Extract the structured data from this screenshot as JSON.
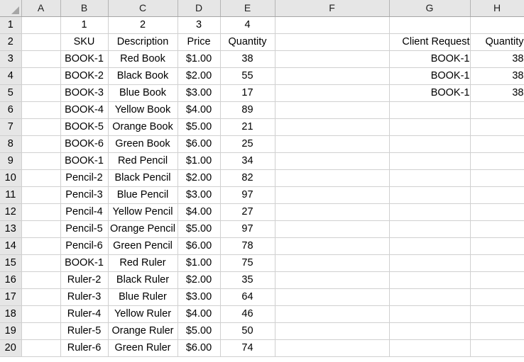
{
  "app": {
    "type": "spreadsheet",
    "select_all_icon": "select-all-triangle-icon"
  },
  "columns": {
    "headers": [
      "A",
      "B",
      "C",
      "D",
      "E",
      "F",
      "G",
      "H"
    ],
    "widths": [
      55,
      67,
      98,
      60,
      77,
      161,
      114,
      76
    ]
  },
  "rows": {
    "numbers": [
      "1",
      "2",
      "3",
      "4",
      "5",
      "6",
      "7",
      "8",
      "9",
      "10",
      "11",
      "12",
      "13",
      "14",
      "15",
      "16",
      "17",
      "18",
      "19",
      "20"
    ]
  },
  "annotations": {
    "row": "1",
    "color": "#ff0000",
    "values": [
      "1",
      "2",
      "3",
      "4"
    ]
  },
  "inventory_table": {
    "header_row": "2",
    "headers": [
      "SKU",
      "Description",
      "Price",
      "Quantity"
    ],
    "rows": [
      {
        "row": "3",
        "sku": "BOOK-1",
        "description": "Red Book",
        "price": "$1.00",
        "quantity": "38",
        "sku_highlight": "pink",
        "row_highlight": "green"
      },
      {
        "row": "4",
        "sku": "BOOK-2",
        "description": "Black Book",
        "price": "$2.00",
        "quantity": "55",
        "sku_highlight": "none",
        "row_highlight": "none"
      },
      {
        "row": "5",
        "sku": "BOOK-3",
        "description": "Blue Book",
        "price": "$3.00",
        "quantity": "17",
        "sku_highlight": "none",
        "row_highlight": "none"
      },
      {
        "row": "6",
        "sku": "BOOK-4",
        "description": "Yellow Book",
        "price": "$4.00",
        "quantity": "89",
        "sku_highlight": "none",
        "row_highlight": "none"
      },
      {
        "row": "7",
        "sku": "BOOK-5",
        "description": "Orange Book",
        "price": "$5.00",
        "quantity": "21",
        "sku_highlight": "none",
        "row_highlight": "none"
      },
      {
        "row": "8",
        "sku": "BOOK-6",
        "description": "Green Book",
        "price": "$6.00",
        "quantity": "25",
        "sku_highlight": "none",
        "row_highlight": "none"
      },
      {
        "row": "9",
        "sku": "BOOK-1",
        "description": "Red Pencil",
        "price": "$1.00",
        "quantity": "34",
        "sku_highlight": "pink",
        "row_highlight": "yellow"
      },
      {
        "row": "10",
        "sku": "Pencil-2",
        "description": "Black Pencil",
        "price": "$2.00",
        "quantity": "82",
        "sku_highlight": "none",
        "row_highlight": "none"
      },
      {
        "row": "11",
        "sku": "Pencil-3",
        "description": "Blue Pencil",
        "price": "$3.00",
        "quantity": "97",
        "sku_highlight": "none",
        "row_highlight": "none"
      },
      {
        "row": "12",
        "sku": "Pencil-4",
        "description": "Yellow Pencil",
        "price": "$4.00",
        "quantity": "27",
        "sku_highlight": "none",
        "row_highlight": "none"
      },
      {
        "row": "13",
        "sku": "Pencil-5",
        "description": "Orange Pencil",
        "price": "$5.00",
        "quantity": "97",
        "sku_highlight": "none",
        "row_highlight": "none"
      },
      {
        "row": "14",
        "sku": "Pencil-6",
        "description": "Green Pencil",
        "price": "$6.00",
        "quantity": "78",
        "sku_highlight": "none",
        "row_highlight": "none"
      },
      {
        "row": "15",
        "sku": "BOOK-1",
        "description": "Red Ruler",
        "price": "$1.00",
        "quantity": "75",
        "sku_highlight": "pink",
        "row_highlight": "yellow"
      },
      {
        "row": "16",
        "sku": "Ruler-2",
        "description": "Black Ruler",
        "price": "$2.00",
        "quantity": "35",
        "sku_highlight": "none",
        "row_highlight": "none"
      },
      {
        "row": "17",
        "sku": "Ruler-3",
        "description": "Blue Ruler",
        "price": "$3.00",
        "quantity": "64",
        "sku_highlight": "none",
        "row_highlight": "none"
      },
      {
        "row": "18",
        "sku": "Ruler-4",
        "description": "Yellow Ruler",
        "price": "$4.00",
        "quantity": "46",
        "sku_highlight": "none",
        "row_highlight": "none"
      },
      {
        "row": "19",
        "sku": "Ruler-5",
        "description": "Orange Ruler",
        "price": "$5.00",
        "quantity": "50",
        "sku_highlight": "none",
        "row_highlight": "none"
      },
      {
        "row": "20",
        "sku": "Ruler-6",
        "description": "Green Ruler",
        "price": "$6.00",
        "quantity": "74",
        "sku_highlight": "none",
        "row_highlight": "none"
      }
    ]
  },
  "client_request_table": {
    "header_row": "2",
    "headers": [
      "Client Request",
      "Quantity"
    ],
    "rows": [
      {
        "row": "3",
        "request": "BOOK-1",
        "quantity": "38"
      },
      {
        "row": "4",
        "request": "BOOK-1",
        "quantity": "38"
      },
      {
        "row": "5",
        "request": "BOOK-1",
        "quantity": "38"
      }
    ]
  },
  "colors": {
    "highlight_green": "#92d050",
    "highlight_yellow": "#ffff00",
    "highlight_pink_bg": "#ffc7ce",
    "highlight_pink_text": "#9c0006",
    "annotation_red": "#ff0000",
    "header_grey": "#e6e6e6",
    "gridline": "#d0d0d0"
  }
}
